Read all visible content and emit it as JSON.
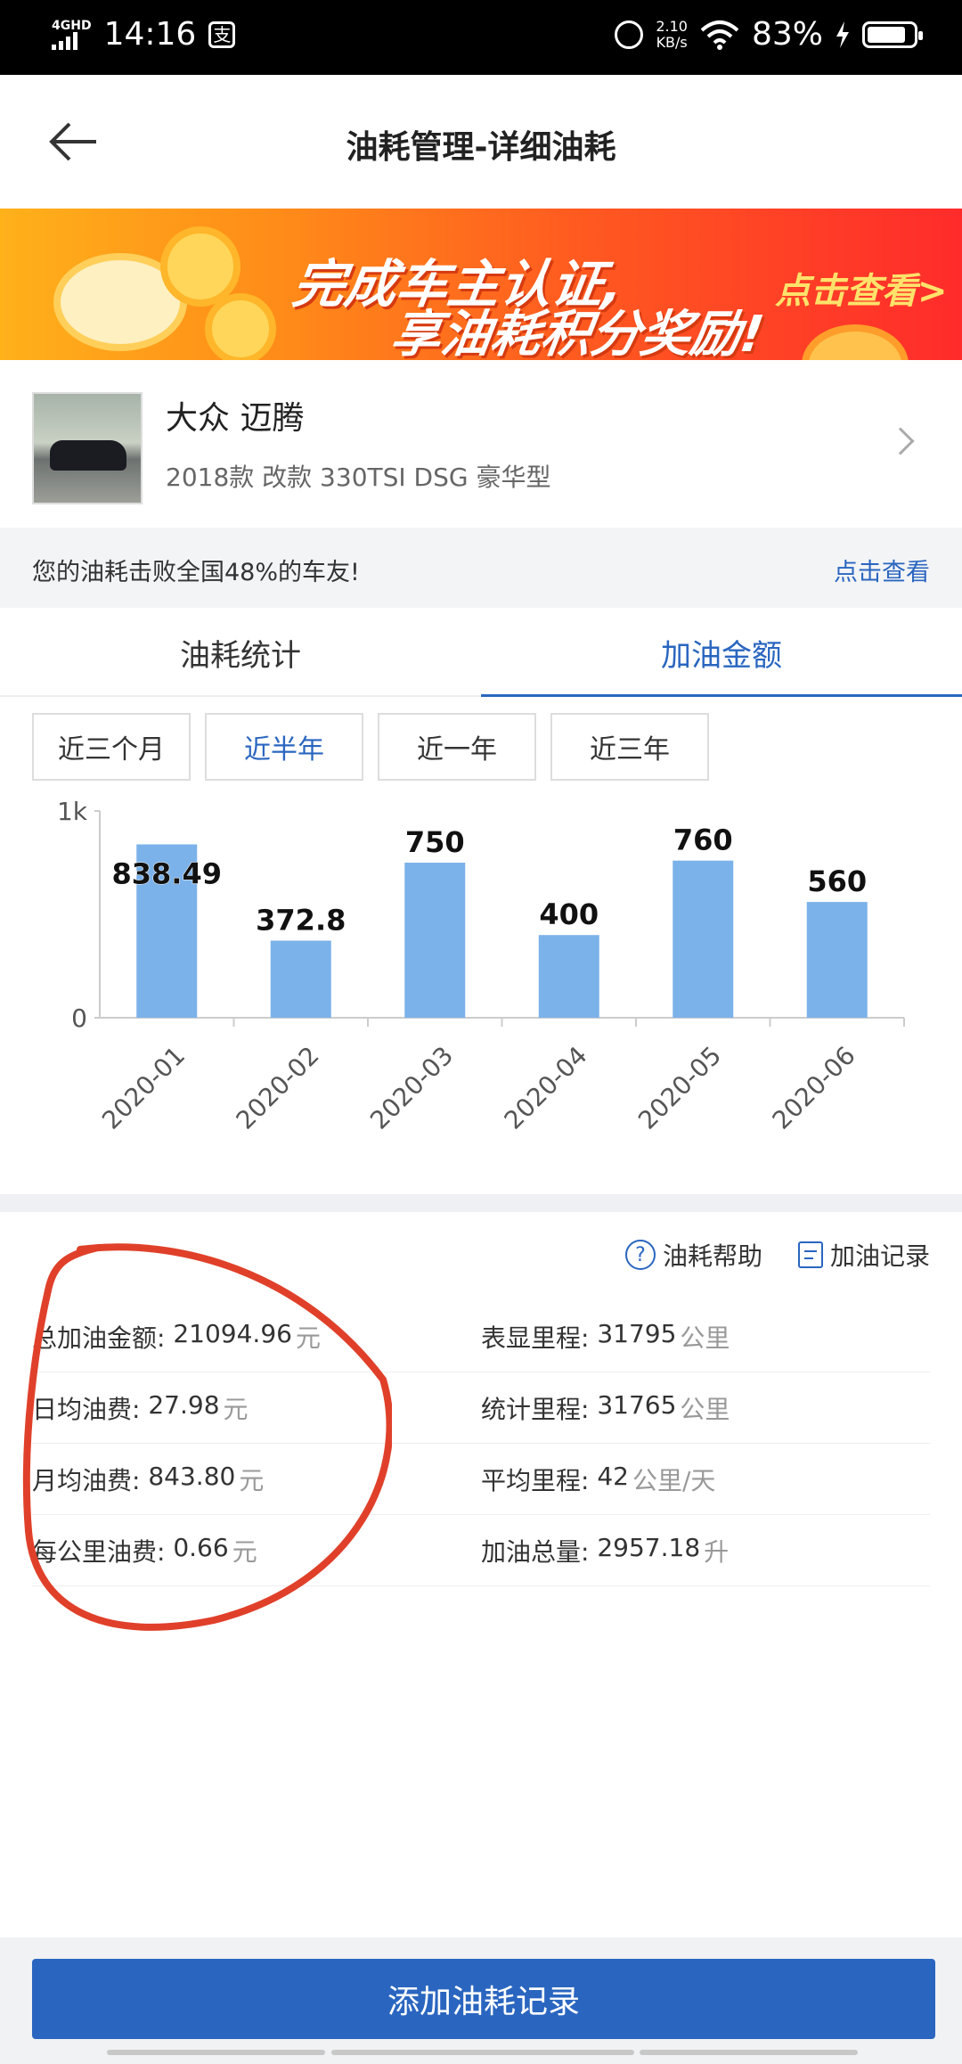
{
  "status_bar": {
    "network": "4GHD",
    "time": "14:16",
    "net_speed_value": "2.10",
    "net_speed_unit": "KB/s",
    "battery": "83%"
  },
  "header": {
    "title": "油耗管理-详细油耗"
  },
  "banner": {
    "line1": "完成车主认证,",
    "line2": "享油耗积分奖励!",
    "cta": "点击查看>"
  },
  "car": {
    "name": "大众 迈腾",
    "model": "2018款 改款 330TSI DSG 豪华型"
  },
  "tip": {
    "message": "您的油耗击败全国48%的车友!",
    "link": "点击查看"
  },
  "tabs": [
    {
      "label": "油耗统计",
      "active": false
    },
    {
      "label": "加油金额",
      "active": true
    }
  ],
  "ranges": [
    {
      "label": "近三个月",
      "active": false
    },
    {
      "label": "近半年",
      "active": true
    },
    {
      "label": "近一年",
      "active": false
    },
    {
      "label": "近三年",
      "active": false
    }
  ],
  "chart_data": {
    "type": "bar",
    "categories": [
      "2020-01",
      "2020-02",
      "2020-03",
      "2020-04",
      "2020-05",
      "2020-06"
    ],
    "values": [
      838.49,
      372.8,
      750,
      400,
      760,
      560
    ],
    "value_labels": [
      "838.49",
      "372.8",
      "750",
      "400",
      "760",
      "560"
    ],
    "ylim": [
      0,
      1000
    ],
    "yticks": [
      "0",
      "1k"
    ],
    "bar_color": "#7cb2ea",
    "grid": false
  },
  "actions": {
    "help": "油耗帮助",
    "records": "加油记录"
  },
  "stats": [
    {
      "label": "总加油金额:",
      "value": "21094.96",
      "unit": "元"
    },
    {
      "label": "表显里程:",
      "value": "31795",
      "unit": "公里"
    },
    {
      "label": "日均油费:",
      "value": "27.98",
      "unit": "元"
    },
    {
      "label": "统计里程:",
      "value": "31765",
      "unit": "公里"
    },
    {
      "label": "月均油费:",
      "value": "843.80",
      "unit": "元"
    },
    {
      "label": "平均里程:",
      "value": "42",
      "unit": "公里/天"
    },
    {
      "label": "每公里油费:",
      "value": "0.66",
      "unit": "元"
    },
    {
      "label": "加油总量:",
      "value": "2957.18",
      "unit": "升"
    }
  ],
  "bottom": {
    "add_button": "添加油耗记录"
  },
  "colors": {
    "accent": "#2a66c0",
    "annotation_circle": "#e0402a"
  }
}
